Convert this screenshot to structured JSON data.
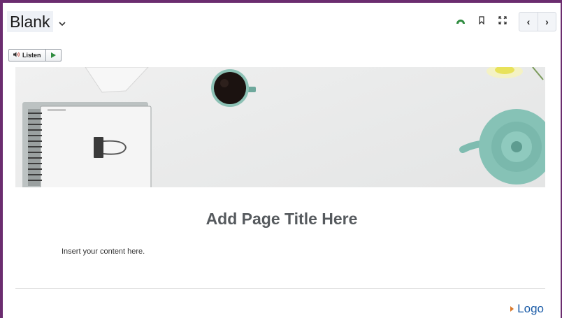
{
  "header": {
    "title": "Blank",
    "icons": [
      "accessibility-icon",
      "bookmark-icon",
      "fullscreen-icon"
    ],
    "prev_label": "‹",
    "next_label": "›"
  },
  "listen": {
    "label": "Listen"
  },
  "content": {
    "page_title": "Add Page Title Here",
    "body": "Insert your content here."
  },
  "footer": {
    "logo_label": "Logo"
  },
  "colors": {
    "frame": "#6b2c6f",
    "accent": "#2e8b3e",
    "link": "#1d5da8",
    "logo_arrow": "#d9782b"
  }
}
